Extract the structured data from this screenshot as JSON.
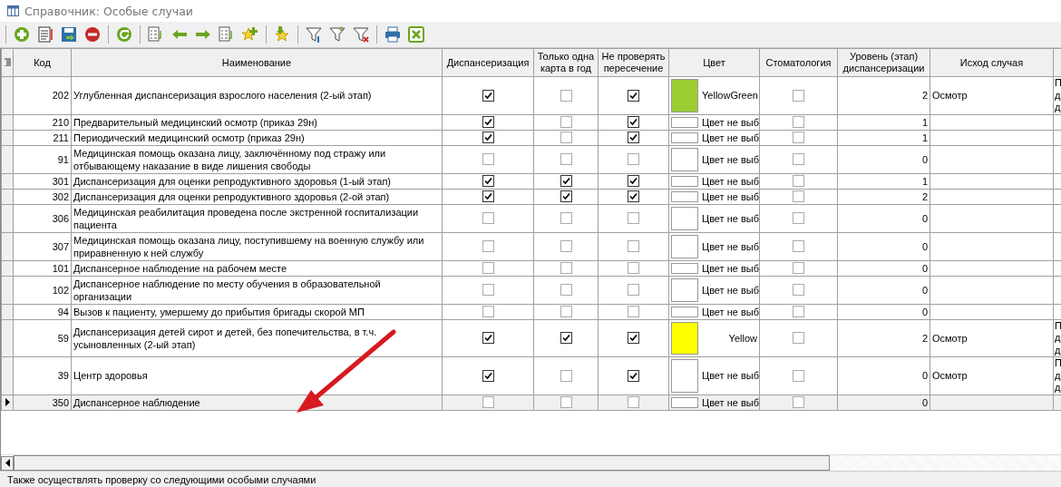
{
  "window": {
    "title": "Справочник: Особые случаи"
  },
  "table": {
    "columns": [
      "Код",
      "Наименование",
      "Диспансеризация",
      "Только одна карта в год",
      "Не проверять пересечение",
      "Цвет",
      "Стоматология",
      "Уровень (этап) диспансеризации",
      "Исход случая"
    ],
    "rows": [
      {
        "code": "202",
        "name": "Углубленная диспансеризация взрослого населения (2-ый этап)",
        "dispensary": true,
        "one_card": false,
        "no_check": true,
        "color_name": "YellowGreen",
        "color": "#9acd32",
        "dental": false,
        "level_text": "2",
        "outcome": "Осмотр",
        "column_10": [
          "П",
          "д",
          "д"
        ],
        "selected": false
      },
      {
        "code": "210",
        "name": "Предварительный медицинский осмотр (приказ 29н)",
        "dispensary": true,
        "one_card": false,
        "no_check": true,
        "color_name": "Цвет не выб",
        "dental": false,
        "level_text": "1",
        "selected": false
      },
      {
        "code": "211",
        "name": "Периодический медицинский осмотр (приказ 29н)",
        "dispensary": true,
        "one_card": false,
        "no_check": true,
        "color_name": "Цвет не выб",
        "dental": false,
        "level_text": "1",
        "selected": false
      },
      {
        "code": "91",
        "name": "Медицинская помощь оказана лицу, заключённому под стражу или отбывающему наказание в виде лишения свободы",
        "dispensary": false,
        "one_card": false,
        "no_check": false,
        "color_name": "Цвет не выб",
        "dental": false,
        "level_text": "0",
        "selected": false
      },
      {
        "code": "301",
        "name": "Диспансеризация для оценки репродуктивного здоровья (1-ый этап)",
        "dispensary": true,
        "one_card": true,
        "no_check": true,
        "color_name": "Цвет не выб",
        "dental": false,
        "level_text": "1",
        "selected": false
      },
      {
        "code": "302",
        "name": "Диспансеризация для оценки репродуктивного здоровья (2-ой этап)",
        "dispensary": true,
        "one_card": true,
        "no_check": true,
        "color_name": "Цвет не выб",
        "dental": false,
        "level_text": "2",
        "selected": false
      },
      {
        "code": "306",
        "name": "Медицинская реабилитация проведена после экстренной госпитализации пациента",
        "dispensary": false,
        "one_card": false,
        "no_check": false,
        "color_name": "Цвет не выб",
        "dental": false,
        "level_text": "0",
        "selected": false
      },
      {
        "code": "307",
        "name": "Медицинская помощь оказана лицу, поступившему на военную службу или приравненную к ней службу",
        "dispensary": false,
        "one_card": false,
        "no_check": false,
        "color_name": "Цвет не выб",
        "dental": false,
        "level_text": "0",
        "selected": false
      },
      {
        "code": "101",
        "name": "Диспансерное наблюдение на рабочем месте",
        "dispensary": false,
        "one_card": false,
        "no_check": false,
        "color_name": "Цвет не выб",
        "dental": false,
        "level_text": "0",
        "selected": false
      },
      {
        "code": "102",
        "name": "Диспансерное наблюдение по месту обучения в образовательной организации",
        "dispensary": false,
        "one_card": false,
        "no_check": false,
        "color_name": "Цвет не выб",
        "dental": false,
        "level_text": "0",
        "selected": false
      },
      {
        "code": "94",
        "name": "Вызов к пациенту, умершему до прибытия бригады скорой МП",
        "dispensary": false,
        "one_card": false,
        "no_check": false,
        "color_name": "Цвет не выб",
        "dental": false,
        "level_text": "0",
        "selected": false
      },
      {
        "code": "59",
        "name": "Диспансеризация детей сирот и детей, без попечительства, в т.ч. усыновленных (2-ый этап)",
        "dispensary": true,
        "one_card": true,
        "no_check": true,
        "color_name": "Yellow",
        "color": "#ffff00",
        "dental": false,
        "level_text": "2",
        "outcome": "Осмотр",
        "column_10": [
          "П",
          "д",
          "д"
        ],
        "selected": false
      },
      {
        "code": "39",
        "name": "Центр здоровья",
        "dispensary": true,
        "one_card": false,
        "no_check": true,
        "color_name": "Цвет не выб",
        "dental": false,
        "level_text": "0",
        "outcome": "Осмотр",
        "column_10": [
          "П",
          "д",
          "д"
        ],
        "selected": false
      },
      {
        "code": "350",
        "name": "Диспансерное наблюдение",
        "dispensary": false,
        "one_card": false,
        "no_check": false,
        "color_name": "Цвет не выб",
        "dental": false,
        "level_text": "0",
        "selected": true
      }
    ]
  },
  "status_bar": {
    "text": "Также осуществлять проверку со следующими особыми случаями"
  }
}
